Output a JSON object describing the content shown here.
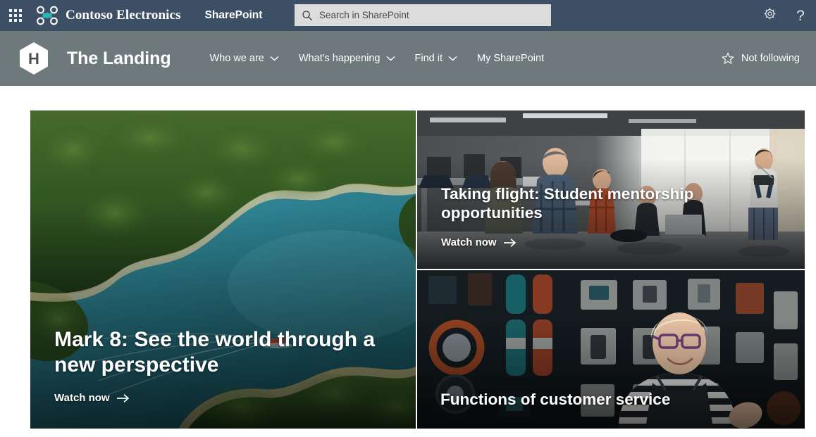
{
  "suite_bar": {
    "waffle_label": "App launcher",
    "waffle_icon": "waffle-grid-icon",
    "brand_logo_icon": "contoso-drone-logo",
    "brand_name": "Contoso Electronics",
    "app_name": "SharePoint",
    "search": {
      "icon": "search-icon",
      "placeholder": "Search in SharePoint",
      "value": ""
    },
    "settings_icon": "gear-icon",
    "help_icon": "question-mark-icon",
    "help_glyph": "?",
    "background_color": "#3c4f64"
  },
  "site_header": {
    "logo_icon": "hexagon-h-site-logo",
    "logo_letter": "H",
    "title": "The Landing",
    "nav_items": [
      {
        "label": "Who we are",
        "has_chevron": true,
        "icon": "chevron-down-icon"
      },
      {
        "label": "What's happening",
        "has_chevron": true,
        "icon": "chevron-down-icon"
      },
      {
        "label": "Find it",
        "has_chevron": true,
        "icon": "chevron-down-icon"
      },
      {
        "label": "My SharePoint",
        "has_chevron": false,
        "icon": ""
      }
    ],
    "follow": {
      "label": "Not following",
      "icon": "star-outline-icon"
    },
    "background_color": "#6d797b"
  },
  "hero": {
    "tiles": [
      {
        "id": "hero-large",
        "title": "Mark 8: See the world through a new perspective",
        "cta_label": "Watch now",
        "cta_icon": "arrow-right-icon",
        "has_cta": true,
        "image_description": "Aerial drone view of a turquoise lake with forested islands and a small boat"
      },
      {
        "id": "hero-top-right",
        "title": "Taking flight: Student mentorship opportunities",
        "cta_label": "Watch now",
        "cta_icon": "arrow-right-icon",
        "has_cta": true,
        "image_description": "Students and a mentor seated in a classroom makerspace with whiteboards"
      },
      {
        "id": "hero-bottom-right",
        "title": "Functions of customer service",
        "cta_label": "",
        "cta_icon": "",
        "has_cta": false,
        "image_description": "Smiling store employee in striped shirt and apron in front of a product wall"
      }
    ]
  },
  "colors": {
    "suite_bar": "#3c4f64",
    "site_header": "#6d797b",
    "brand_accent": "#2fb3b3",
    "page_background": "#ffffff",
    "search_field": "#dcdcdc"
  }
}
